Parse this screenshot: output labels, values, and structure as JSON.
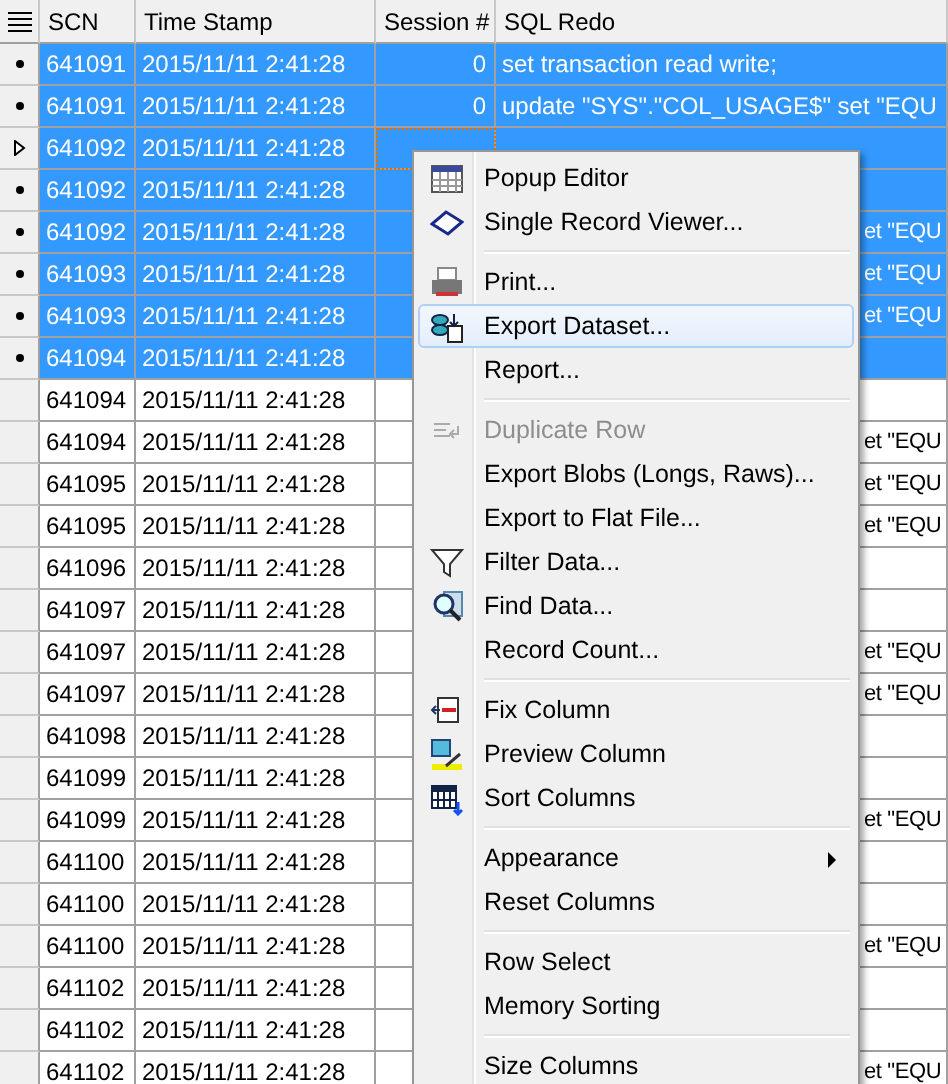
{
  "grid": {
    "columns": [
      "SCN",
      "Time Stamp",
      "Session #",
      "SQL Redo"
    ],
    "rows": [
      {
        "scn": "641091",
        "time": "2015/11/11 2:41:28",
        "session": "0",
        "sql": "set transaction read write;",
        "selected": true,
        "current": false,
        "sql_covered": false
      },
      {
        "scn": "641091",
        "time": "2015/11/11 2:41:28",
        "session": "0",
        "sql": "update \"SYS\".\"COL_USAGE$\" set \"EQU",
        "selected": true,
        "current": false,
        "sql_covered": false
      },
      {
        "scn": "641092",
        "time": "2015/11/11 2:41:28",
        "selected": true,
        "current": true
      },
      {
        "scn": "641092",
        "time": "2015/11/11 2:41:28",
        "selected": true,
        "current": false
      },
      {
        "scn": "641092",
        "time": "2015/11/11 2:41:28",
        "sql": "et \"EQU",
        "selected": true,
        "current": false,
        "sql_covered": true
      },
      {
        "scn": "641093",
        "time": "2015/11/11 2:41:28",
        "sql": "et \"EQU",
        "selected": true,
        "current": false,
        "sql_covered": true
      },
      {
        "scn": "641093",
        "time": "2015/11/11 2:41:28",
        "sql": "et \"EQU",
        "selected": true,
        "current": false,
        "sql_covered": true
      },
      {
        "scn": "641094",
        "time": "2015/11/11 2:41:28",
        "selected": true,
        "current": false
      },
      {
        "scn": "641094",
        "time": "2015/11/11 2:41:28",
        "selected": false,
        "current": false
      },
      {
        "scn": "641094",
        "time": "2015/11/11 2:41:28",
        "sql": "et \"EQU",
        "selected": false,
        "current": false,
        "sql_covered": true
      },
      {
        "scn": "641095",
        "time": "2015/11/11 2:41:28",
        "sql": "et \"EQU",
        "selected": false,
        "current": false,
        "sql_covered": true
      },
      {
        "scn": "641095",
        "time": "2015/11/11 2:41:28",
        "sql": "et \"EQU",
        "selected": false,
        "current": false,
        "sql_covered": true
      },
      {
        "scn": "641096",
        "time": "2015/11/11 2:41:28",
        "selected": false,
        "current": false
      },
      {
        "scn": "641097",
        "time": "2015/11/11 2:41:28",
        "selected": false,
        "current": false
      },
      {
        "scn": "641097",
        "time": "2015/11/11 2:41:28",
        "sql": "et \"EQU",
        "selected": false,
        "current": false,
        "sql_covered": true
      },
      {
        "scn": "641097",
        "time": "2015/11/11 2:41:28",
        "sql": "et \"EQU",
        "selected": false,
        "current": false,
        "sql_covered": true
      },
      {
        "scn": "641098",
        "time": "2015/11/11 2:41:28",
        "selected": false,
        "current": false
      },
      {
        "scn": "641099",
        "time": "2015/11/11 2:41:28",
        "selected": false,
        "current": false
      },
      {
        "scn": "641099",
        "time": "2015/11/11 2:41:28",
        "sql": "et \"EQU",
        "selected": false,
        "current": false,
        "sql_covered": true
      },
      {
        "scn": "641100",
        "time": "2015/11/11 2:41:28",
        "selected": false,
        "current": false
      },
      {
        "scn": "641100",
        "time": "2015/11/11 2:41:28",
        "selected": false,
        "current": false
      },
      {
        "scn": "641100",
        "time": "2015/11/11 2:41:28",
        "sql": "et \"EQU",
        "selected": false,
        "current": false,
        "sql_covered": true
      },
      {
        "scn": "641102",
        "time": "2015/11/11 2:41:28",
        "selected": false,
        "current": false
      },
      {
        "scn": "641102",
        "time": "2015/11/11 2:41:28",
        "selected": false,
        "current": false
      },
      {
        "scn": "641102",
        "time": "2015/11/11 2:41:28",
        "sql": "et \"EQU",
        "selected": false,
        "current": false,
        "sql_covered": true
      }
    ]
  },
  "context_menu": [
    {
      "kind": "item",
      "label": "Popup Editor",
      "disabled": false,
      "selected": false,
      "submenu": false
    },
    {
      "kind": "item",
      "label": "Single Record Viewer...",
      "disabled": false,
      "selected": false,
      "submenu": false
    },
    {
      "kind": "separator"
    },
    {
      "kind": "item",
      "label": "Print...",
      "disabled": false,
      "selected": false,
      "submenu": false
    },
    {
      "kind": "item",
      "label": "Export Dataset...",
      "disabled": false,
      "selected": true,
      "submenu": false
    },
    {
      "kind": "item",
      "label": "Report...",
      "disabled": false,
      "selected": false,
      "submenu": false
    },
    {
      "kind": "separator"
    },
    {
      "kind": "item",
      "label": "Duplicate Row",
      "disabled": true,
      "selected": false,
      "submenu": false
    },
    {
      "kind": "item",
      "label": "Export Blobs (Longs, Raws)...",
      "disabled": false,
      "selected": false,
      "submenu": false
    },
    {
      "kind": "item",
      "label": "Export to Flat File...",
      "disabled": false,
      "selected": false,
      "submenu": false
    },
    {
      "kind": "item",
      "label": "Filter Data...",
      "disabled": false,
      "selected": false,
      "submenu": false
    },
    {
      "kind": "item",
      "label": "Find Data...",
      "disabled": false,
      "selected": false,
      "submenu": false
    },
    {
      "kind": "item",
      "label": "Record Count...",
      "disabled": false,
      "selected": false,
      "submenu": false
    },
    {
      "kind": "separator"
    },
    {
      "kind": "item",
      "label": "Fix Column",
      "disabled": false,
      "selected": false,
      "submenu": false
    },
    {
      "kind": "item",
      "label": "Preview Column",
      "disabled": false,
      "selected": false,
      "submenu": false
    },
    {
      "kind": "item",
      "label": "Sort Columns",
      "disabled": false,
      "selected": false,
      "submenu": false
    },
    {
      "kind": "separator"
    },
    {
      "kind": "item",
      "label": "Appearance",
      "disabled": false,
      "selected": false,
      "submenu": true
    },
    {
      "kind": "item",
      "label": "Reset Columns",
      "disabled": false,
      "selected": false,
      "submenu": false
    },
    {
      "kind": "separator"
    },
    {
      "kind": "item",
      "label": "Row Select",
      "disabled": false,
      "selected": false,
      "submenu": false
    },
    {
      "kind": "item",
      "label": "Memory Sorting",
      "disabled": false,
      "selected": false,
      "submenu": false
    },
    {
      "kind": "separator"
    },
    {
      "kind": "item",
      "label": "Size Columns",
      "disabled": false,
      "selected": false,
      "submenu": false
    }
  ]
}
